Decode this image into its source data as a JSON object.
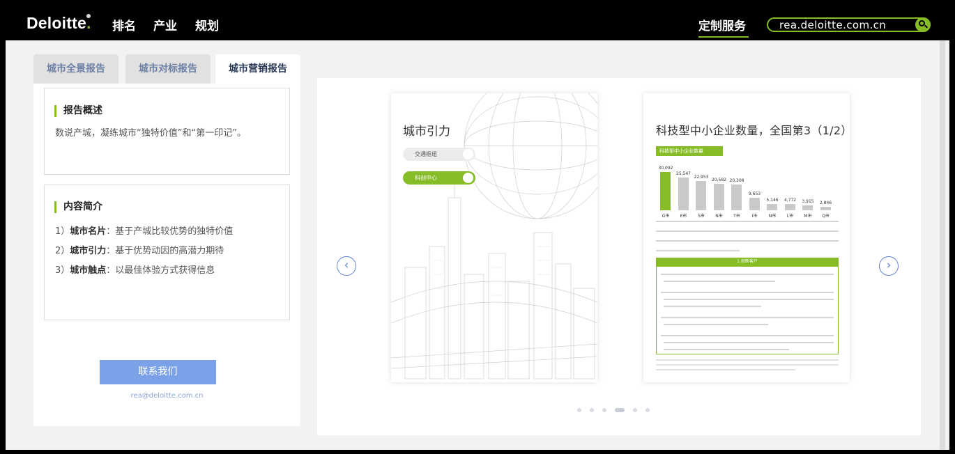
{
  "header": {
    "logo": "Deloitte",
    "logo_dot": ".",
    "nav": [
      "排名",
      "产业",
      "规划"
    ],
    "service": "定制服务",
    "search_text": "rea.deloitte.com.cn",
    "accent": "#86bc25"
  },
  "tabs": [
    {
      "label": "城市全景报告",
      "active": false
    },
    {
      "label": "城市对标报告",
      "active": false
    },
    {
      "label": "城市营销报告",
      "active": true
    }
  ],
  "overview": {
    "title": "报告概述",
    "text": "数说产城，凝练城市“独特价值”和“第一印记”。"
  },
  "intro": {
    "title": "内容简介",
    "items": [
      {
        "num": "1）",
        "key": "城市名片",
        "text": "：基于产城比较优势的独特价值"
      },
      {
        "num": "2）",
        "key": "城市引力",
        "text": "：基于优势动因的高潜力期待"
      },
      {
        "num": "3）",
        "key": "城市触点",
        "text": "：以最佳体验方式获得信息"
      }
    ]
  },
  "contact": {
    "button": "联系我们",
    "email": "rea@deloitte.com.cn"
  },
  "slide1": {
    "title": "城市引力",
    "pill_off": "交通枢纽",
    "pill_on": "科创中心"
  },
  "slide2": {
    "title": "科技型中小企业数量，全国第3（1/2）",
    "chip": "科技型中小企业数量",
    "band": "1.创新客户"
  },
  "chart_data": {
    "type": "bar",
    "categories": [
      "G市",
      "E市",
      "S市",
      "N市",
      "T市",
      "I市",
      "N市",
      "L市",
      "M市",
      "Q市"
    ],
    "values": [
      30092,
      25547,
      22953,
      20582,
      20308,
      9653,
      5146,
      4772,
      3915,
      2846
    ],
    "value_labels": [
      "30,092",
      "25,547",
      "22,953",
      "20,582",
      "20,308",
      "9,653",
      "5,146",
      "4,772",
      "3,915",
      "2,846"
    ]
  },
  "carousel": {
    "pages": 6,
    "active": 3
  }
}
